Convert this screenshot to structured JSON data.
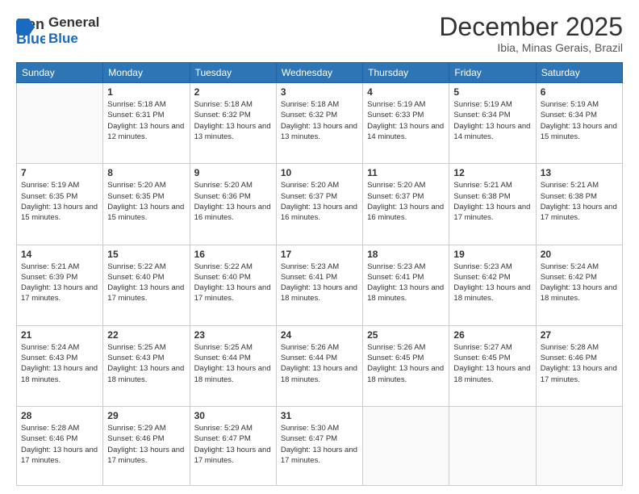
{
  "header": {
    "logo_general": "General",
    "logo_blue": "Blue",
    "month_title": "December 2025",
    "subtitle": "Ibia, Minas Gerais, Brazil"
  },
  "days_of_week": [
    "Sunday",
    "Monday",
    "Tuesday",
    "Wednesday",
    "Thursday",
    "Friday",
    "Saturday"
  ],
  "weeks": [
    [
      {
        "day": "",
        "sunrise": "",
        "sunset": "",
        "daylight": ""
      },
      {
        "day": "1",
        "sunrise": "Sunrise: 5:18 AM",
        "sunset": "Sunset: 6:31 PM",
        "daylight": "Daylight: 13 hours and 12 minutes."
      },
      {
        "day": "2",
        "sunrise": "Sunrise: 5:18 AM",
        "sunset": "Sunset: 6:32 PM",
        "daylight": "Daylight: 13 hours and 13 minutes."
      },
      {
        "day": "3",
        "sunrise": "Sunrise: 5:18 AM",
        "sunset": "Sunset: 6:32 PM",
        "daylight": "Daylight: 13 hours and 13 minutes."
      },
      {
        "day": "4",
        "sunrise": "Sunrise: 5:19 AM",
        "sunset": "Sunset: 6:33 PM",
        "daylight": "Daylight: 13 hours and 14 minutes."
      },
      {
        "day": "5",
        "sunrise": "Sunrise: 5:19 AM",
        "sunset": "Sunset: 6:34 PM",
        "daylight": "Daylight: 13 hours and 14 minutes."
      },
      {
        "day": "6",
        "sunrise": "Sunrise: 5:19 AM",
        "sunset": "Sunset: 6:34 PM",
        "daylight": "Daylight: 13 hours and 15 minutes."
      }
    ],
    [
      {
        "day": "7",
        "sunrise": "Sunrise: 5:19 AM",
        "sunset": "Sunset: 6:35 PM",
        "daylight": "Daylight: 13 hours and 15 minutes."
      },
      {
        "day": "8",
        "sunrise": "Sunrise: 5:20 AM",
        "sunset": "Sunset: 6:35 PM",
        "daylight": "Daylight: 13 hours and 15 minutes."
      },
      {
        "day": "9",
        "sunrise": "Sunrise: 5:20 AM",
        "sunset": "Sunset: 6:36 PM",
        "daylight": "Daylight: 13 hours and 16 minutes."
      },
      {
        "day": "10",
        "sunrise": "Sunrise: 5:20 AM",
        "sunset": "Sunset: 6:37 PM",
        "daylight": "Daylight: 13 hours and 16 minutes."
      },
      {
        "day": "11",
        "sunrise": "Sunrise: 5:20 AM",
        "sunset": "Sunset: 6:37 PM",
        "daylight": "Daylight: 13 hours and 16 minutes."
      },
      {
        "day": "12",
        "sunrise": "Sunrise: 5:21 AM",
        "sunset": "Sunset: 6:38 PM",
        "daylight": "Daylight: 13 hours and 17 minutes."
      },
      {
        "day": "13",
        "sunrise": "Sunrise: 5:21 AM",
        "sunset": "Sunset: 6:38 PM",
        "daylight": "Daylight: 13 hours and 17 minutes."
      }
    ],
    [
      {
        "day": "14",
        "sunrise": "Sunrise: 5:21 AM",
        "sunset": "Sunset: 6:39 PM",
        "daylight": "Daylight: 13 hours and 17 minutes."
      },
      {
        "day": "15",
        "sunrise": "Sunrise: 5:22 AM",
        "sunset": "Sunset: 6:40 PM",
        "daylight": "Daylight: 13 hours and 17 minutes."
      },
      {
        "day": "16",
        "sunrise": "Sunrise: 5:22 AM",
        "sunset": "Sunset: 6:40 PM",
        "daylight": "Daylight: 13 hours and 17 minutes."
      },
      {
        "day": "17",
        "sunrise": "Sunrise: 5:23 AM",
        "sunset": "Sunset: 6:41 PM",
        "daylight": "Daylight: 13 hours and 18 minutes."
      },
      {
        "day": "18",
        "sunrise": "Sunrise: 5:23 AM",
        "sunset": "Sunset: 6:41 PM",
        "daylight": "Daylight: 13 hours and 18 minutes."
      },
      {
        "day": "19",
        "sunrise": "Sunrise: 5:23 AM",
        "sunset": "Sunset: 6:42 PM",
        "daylight": "Daylight: 13 hours and 18 minutes."
      },
      {
        "day": "20",
        "sunrise": "Sunrise: 5:24 AM",
        "sunset": "Sunset: 6:42 PM",
        "daylight": "Daylight: 13 hours and 18 minutes."
      }
    ],
    [
      {
        "day": "21",
        "sunrise": "Sunrise: 5:24 AM",
        "sunset": "Sunset: 6:43 PM",
        "daylight": "Daylight: 13 hours and 18 minutes."
      },
      {
        "day": "22",
        "sunrise": "Sunrise: 5:25 AM",
        "sunset": "Sunset: 6:43 PM",
        "daylight": "Daylight: 13 hours and 18 minutes."
      },
      {
        "day": "23",
        "sunrise": "Sunrise: 5:25 AM",
        "sunset": "Sunset: 6:44 PM",
        "daylight": "Daylight: 13 hours and 18 minutes."
      },
      {
        "day": "24",
        "sunrise": "Sunrise: 5:26 AM",
        "sunset": "Sunset: 6:44 PM",
        "daylight": "Daylight: 13 hours and 18 minutes."
      },
      {
        "day": "25",
        "sunrise": "Sunrise: 5:26 AM",
        "sunset": "Sunset: 6:45 PM",
        "daylight": "Daylight: 13 hours and 18 minutes."
      },
      {
        "day": "26",
        "sunrise": "Sunrise: 5:27 AM",
        "sunset": "Sunset: 6:45 PM",
        "daylight": "Daylight: 13 hours and 18 minutes."
      },
      {
        "day": "27",
        "sunrise": "Sunrise: 5:28 AM",
        "sunset": "Sunset: 6:46 PM",
        "daylight": "Daylight: 13 hours and 17 minutes."
      }
    ],
    [
      {
        "day": "28",
        "sunrise": "Sunrise: 5:28 AM",
        "sunset": "Sunset: 6:46 PM",
        "daylight": "Daylight: 13 hours and 17 minutes."
      },
      {
        "day": "29",
        "sunrise": "Sunrise: 5:29 AM",
        "sunset": "Sunset: 6:46 PM",
        "daylight": "Daylight: 13 hours and 17 minutes."
      },
      {
        "day": "30",
        "sunrise": "Sunrise: 5:29 AM",
        "sunset": "Sunset: 6:47 PM",
        "daylight": "Daylight: 13 hours and 17 minutes."
      },
      {
        "day": "31",
        "sunrise": "Sunrise: 5:30 AM",
        "sunset": "Sunset: 6:47 PM",
        "daylight": "Daylight: 13 hours and 17 minutes."
      },
      {
        "day": "",
        "sunrise": "",
        "sunset": "",
        "daylight": ""
      },
      {
        "day": "",
        "sunrise": "",
        "sunset": "",
        "daylight": ""
      },
      {
        "day": "",
        "sunrise": "",
        "sunset": "",
        "daylight": ""
      }
    ]
  ]
}
